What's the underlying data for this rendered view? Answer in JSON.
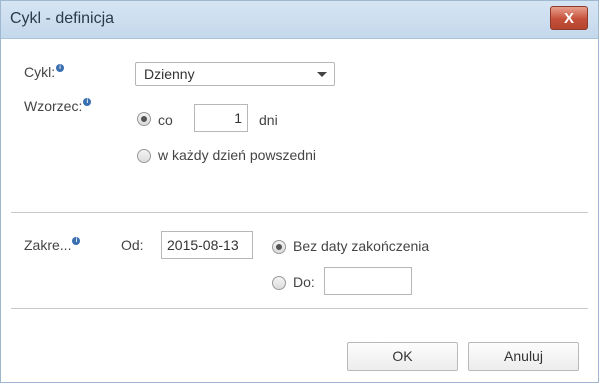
{
  "window": {
    "title": "Cykl - definicja",
    "close_label": "X"
  },
  "form": {
    "cycle_label": "Cykl:",
    "cycle_value": "Dzienny",
    "pattern_label": "Wzorzec:",
    "pattern_every_label": "co",
    "pattern_every_value": "1",
    "pattern_days_label": "dni",
    "pattern_weekday_label": "w każdy dzień powszedni",
    "range_label": "Zakre...",
    "from_label": "Od:",
    "from_value": "2015-08-13",
    "no_end_label": "Bez daty zakończenia",
    "to_label": "Do:",
    "to_value": ""
  },
  "buttons": {
    "ok": "OK",
    "cancel": "Anuluj"
  },
  "icons": {
    "info": "info-icon",
    "close": "close-icon",
    "dropdown": "chevron-down-icon"
  },
  "colors": {
    "titlebar": "#c4d8ec",
    "close": "#c4503a",
    "info": "#3a6fb0"
  }
}
